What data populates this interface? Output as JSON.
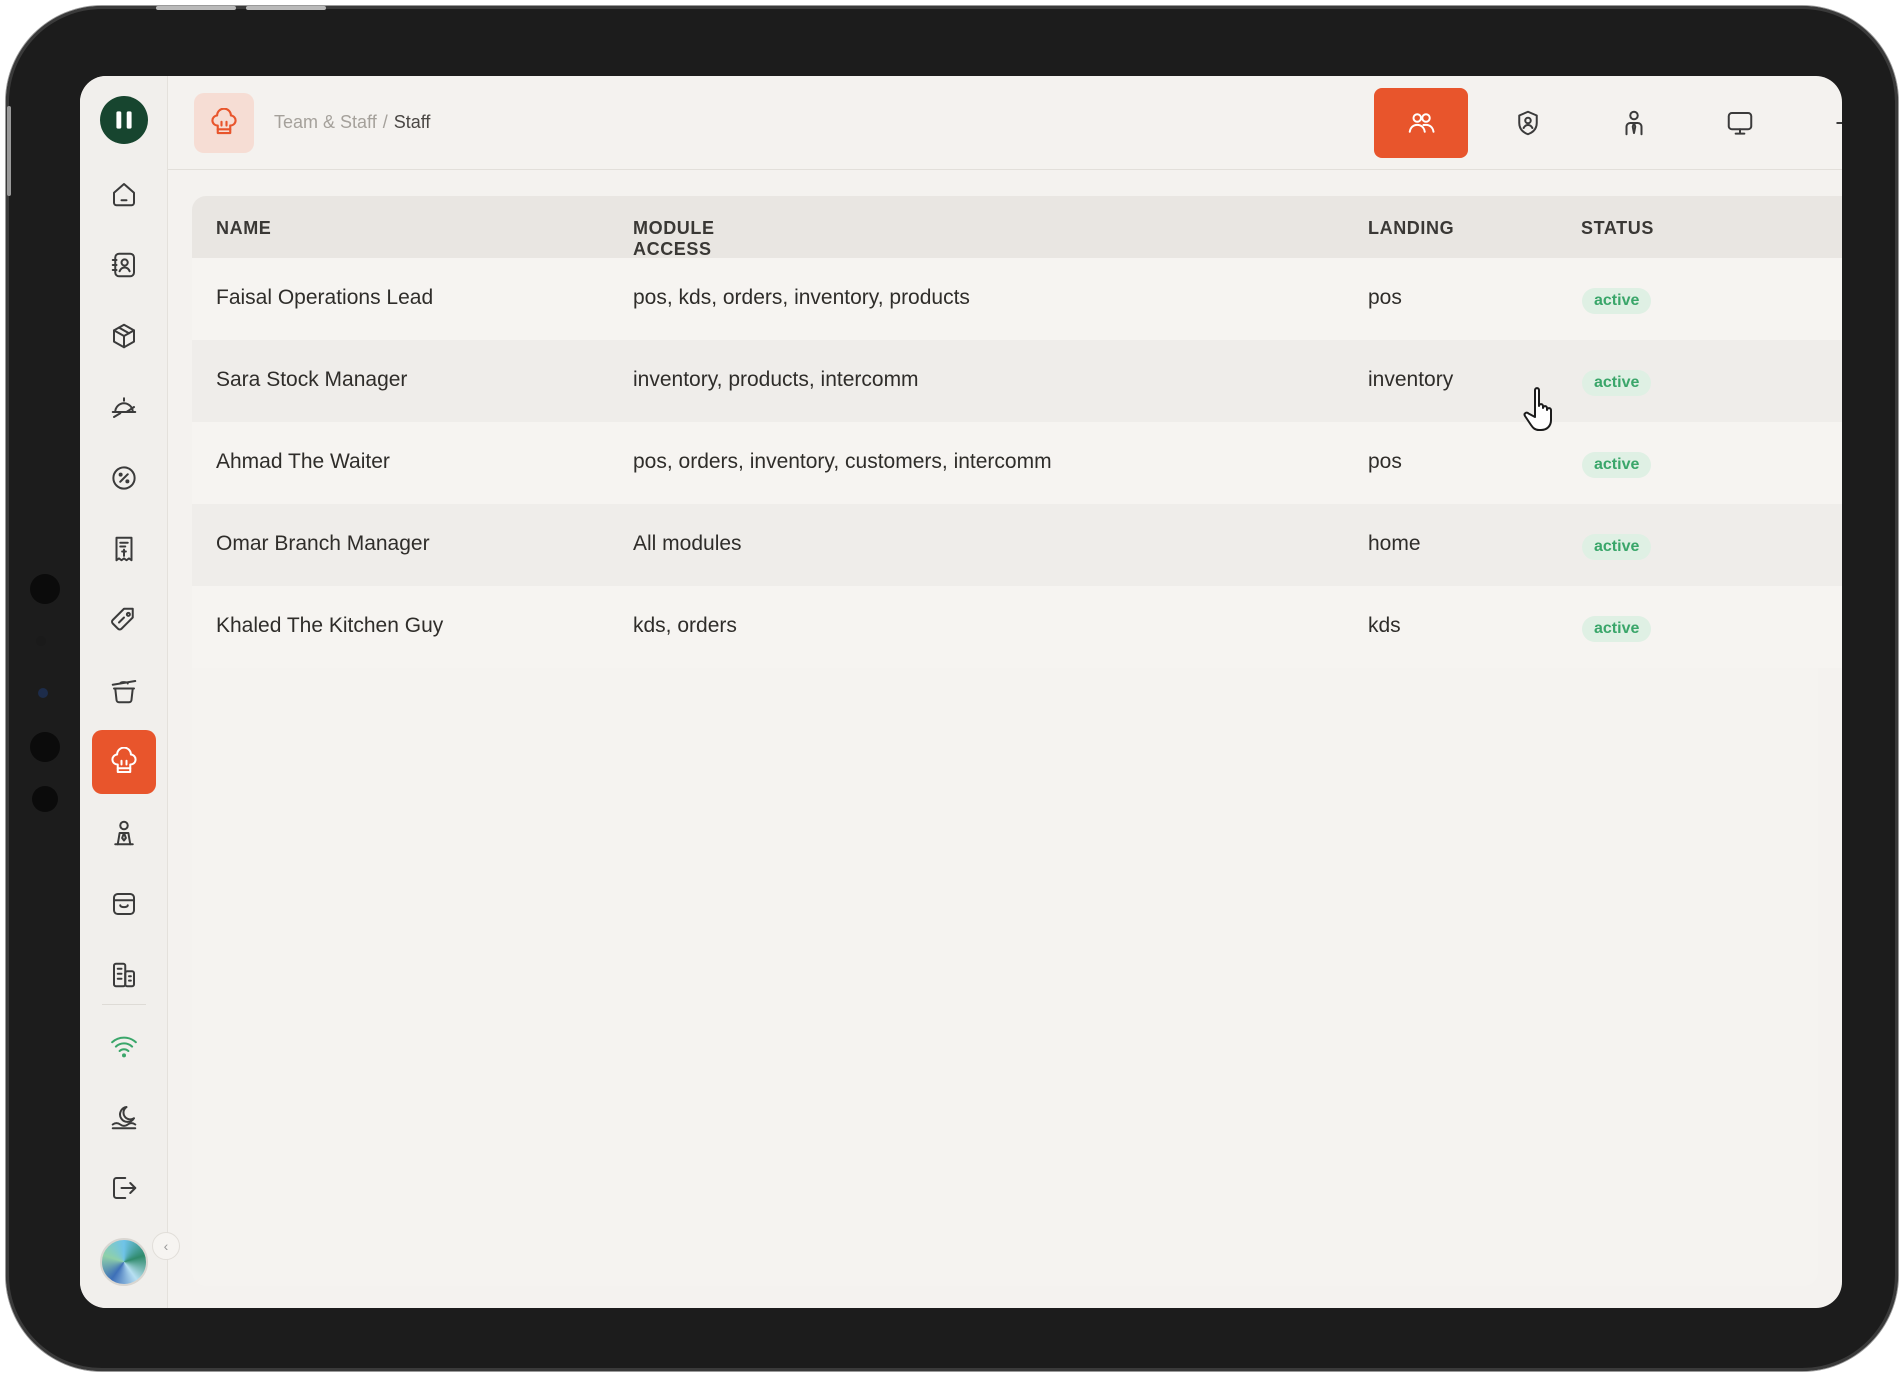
{
  "breadcrumb": {
    "section": "Team & Staff",
    "separator": "/",
    "current": "Staff"
  },
  "sidebar": {
    "items": [
      {
        "icon": "home-icon"
      },
      {
        "icon": "contacts-icon"
      },
      {
        "icon": "box-icon"
      },
      {
        "icon": "serving-dish-icon"
      },
      {
        "icon": "discount-icon"
      },
      {
        "icon": "receipt-icon"
      },
      {
        "icon": "tag-icon"
      },
      {
        "icon": "pot-icon"
      },
      {
        "icon": "chef-hat-icon",
        "active": true
      },
      {
        "icon": "person-icon"
      },
      {
        "icon": "store-icon"
      },
      {
        "icon": "building-icon"
      },
      {
        "icon": "wifi-icon"
      },
      {
        "icon": "theme-icon"
      },
      {
        "icon": "logout-icon"
      }
    ],
    "collapse_glyph": "‹"
  },
  "header_tabs": [
    {
      "icon": "team-icon",
      "active": true
    },
    {
      "icon": "shield-user-icon"
    },
    {
      "icon": "user-tie-icon"
    },
    {
      "icon": "monitor-icon"
    },
    {
      "icon": "plus-icon"
    }
  ],
  "table": {
    "columns": {
      "name": "NAME",
      "module_access": "MODULE ACCESS",
      "landing": "LANDING",
      "status": "STATUS"
    },
    "rows": [
      {
        "name": "Faisal Operations Lead",
        "module_access": "pos, kds, orders, inventory, products",
        "landing": "pos",
        "status": "active"
      },
      {
        "name": "Sara Stock Manager",
        "module_access": "inventory, products, intercomm",
        "landing": "inventory",
        "status": "active"
      },
      {
        "name": "Ahmad The Waiter",
        "module_access": "pos, orders, inventory, customers, intercomm",
        "landing": "pos",
        "status": "active"
      },
      {
        "name": "Omar Branch Manager",
        "module_access": "All modules",
        "landing": "home",
        "status": "active"
      },
      {
        "name": "Khaled The Kitchen Guy",
        "module_access": "kds, orders",
        "landing": "kds",
        "status": "active"
      }
    ],
    "row_menu_glyph": "⋮"
  },
  "colors": {
    "accent": "#e8552c",
    "logo_bg": "#17452f",
    "status_active": "#3aa66a",
    "status_active_bg": "#dff0e4"
  }
}
